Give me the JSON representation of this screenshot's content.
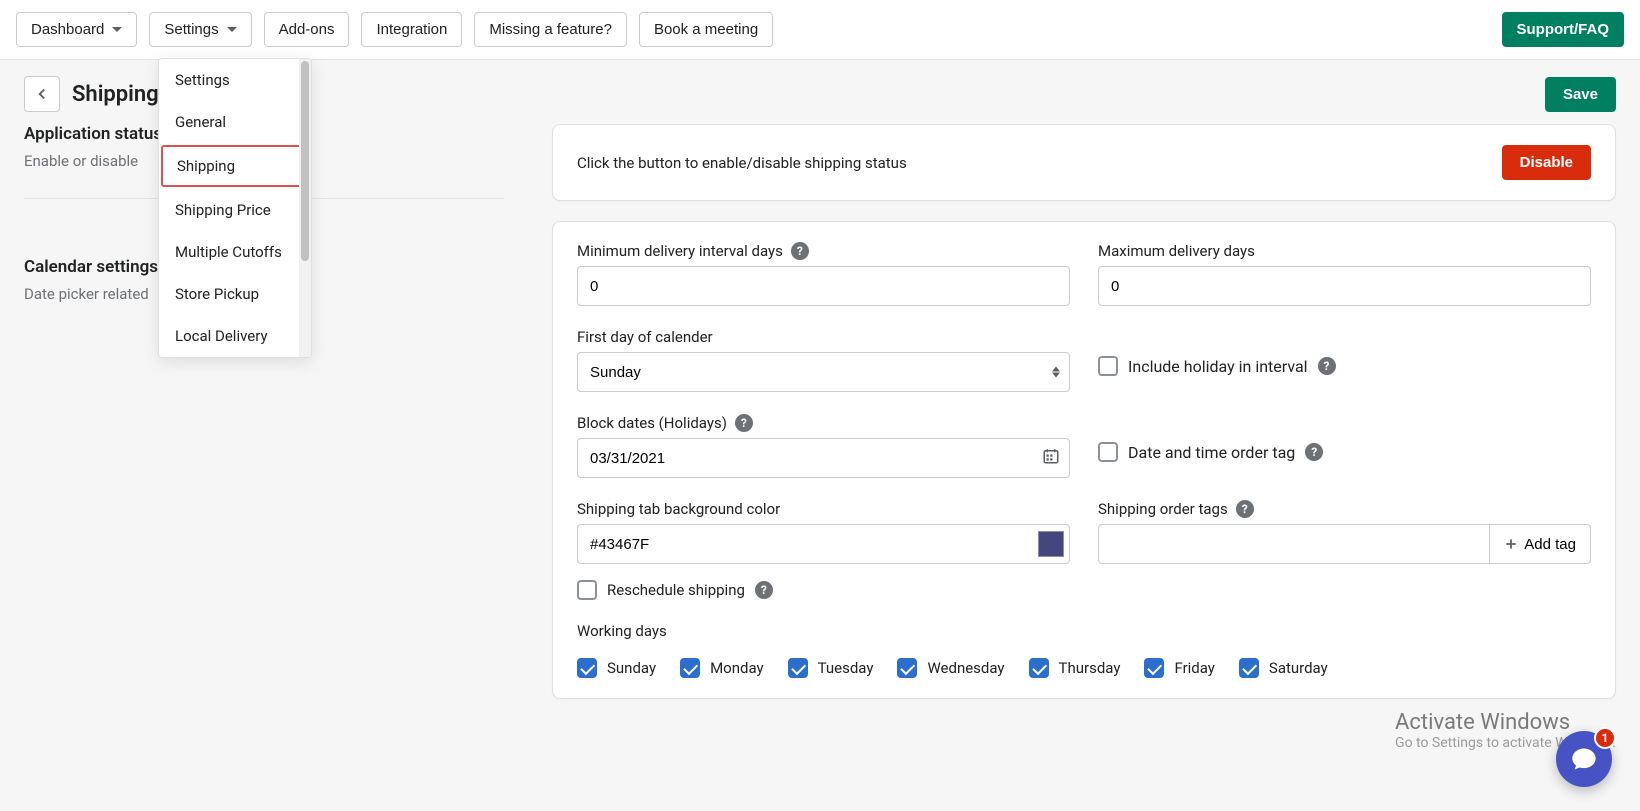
{
  "topnav": {
    "dashboard": "Dashboard",
    "settings": "Settings",
    "addons": "Add-ons",
    "integration": "Integration",
    "missing": "Missing a feature?",
    "book": "Book a meeting",
    "support": "Support/FAQ"
  },
  "settings_menu": {
    "items": [
      "Settings",
      "General",
      "Shipping",
      "Shipping Price",
      "Multiple Cutoffs",
      "Store Pickup",
      "Local Delivery"
    ],
    "highlighted_index": 2
  },
  "page": {
    "title": "Shipping",
    "save": "Save"
  },
  "left": {
    "status_head": "Application status",
    "status_sub": "Enable or disable",
    "calendar_head": "Calendar settings",
    "calendar_sub": "Date picker related"
  },
  "status_card": {
    "text": "Click the button to enable/disable shipping status",
    "button": "Disable"
  },
  "form": {
    "min_label": "Minimum delivery interval days",
    "min_value": "0",
    "max_label": "Maximum delivery days",
    "max_value": "0",
    "firstday_label": "First day of calender",
    "firstday_value": "Sunday",
    "include_holiday": "Include holiday in interval",
    "block_label": "Block dates (Holidays)",
    "block_value": "03/31/2021",
    "datetime_tag": "Date and time order tag",
    "bgcolor_label": "Shipping tab background color",
    "bgcolor_value": "#43467F",
    "reschedule": "Reschedule shipping",
    "ordertags_label": "Shipping order tags",
    "add_tag": "Add tag",
    "working_label": "Working days",
    "days": [
      "Sunday",
      "Monday",
      "Tuesday",
      "Wednesday",
      "Thursday",
      "Friday",
      "Saturday"
    ]
  },
  "windows": {
    "line1": "Activate Windows",
    "line2": "Go to Settings to activate Windows."
  },
  "chat": {
    "badge": "1"
  }
}
